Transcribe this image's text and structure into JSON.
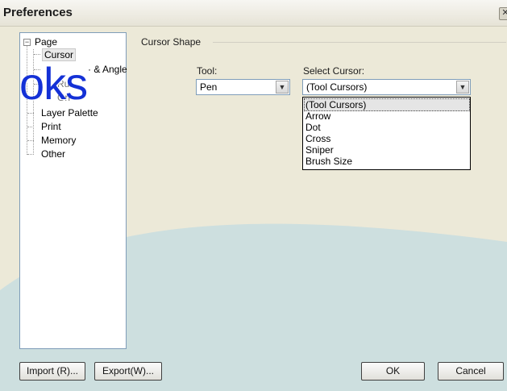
{
  "window": {
    "title": "Preferences",
    "close_glyph": "✕"
  },
  "tree": {
    "items": [
      {
        "label": "Page",
        "expander": "−"
      },
      {
        "label": "Cursor"
      },
      {
        "label": "· & Angle"
      },
      {
        "label": "Rul"
      },
      {
        "label": "Gri"
      },
      {
        "label": "Layer Palette"
      },
      {
        "label": "Print"
      },
      {
        "label": "Memory"
      },
      {
        "label": "Other"
      }
    ]
  },
  "cursor_shape": {
    "group_label": "Cursor Shape",
    "tool": {
      "label": "Tool:",
      "value": "Pen"
    },
    "select_cursor": {
      "label": "Select Cursor:",
      "value": "(Tool Cursors)",
      "options": [
        "(Tool Cursors)",
        "Arrow",
        "Dot",
        "Cross",
        "Sniper",
        "Brush Size"
      ],
      "highlighted_option": "(Tool Cursors)"
    }
  },
  "watermark": {
    "text": "oks"
  },
  "buttons": {
    "import": "Import (R)...",
    "export": "Export(W)...",
    "ok": "OK",
    "cancel": "Cancel"
  },
  "colors": {
    "dialog_bg": "#ece9d8",
    "swoosh": "#c8dde1",
    "tree_border": "#7f9db9",
    "watermark": "#1431d6"
  }
}
